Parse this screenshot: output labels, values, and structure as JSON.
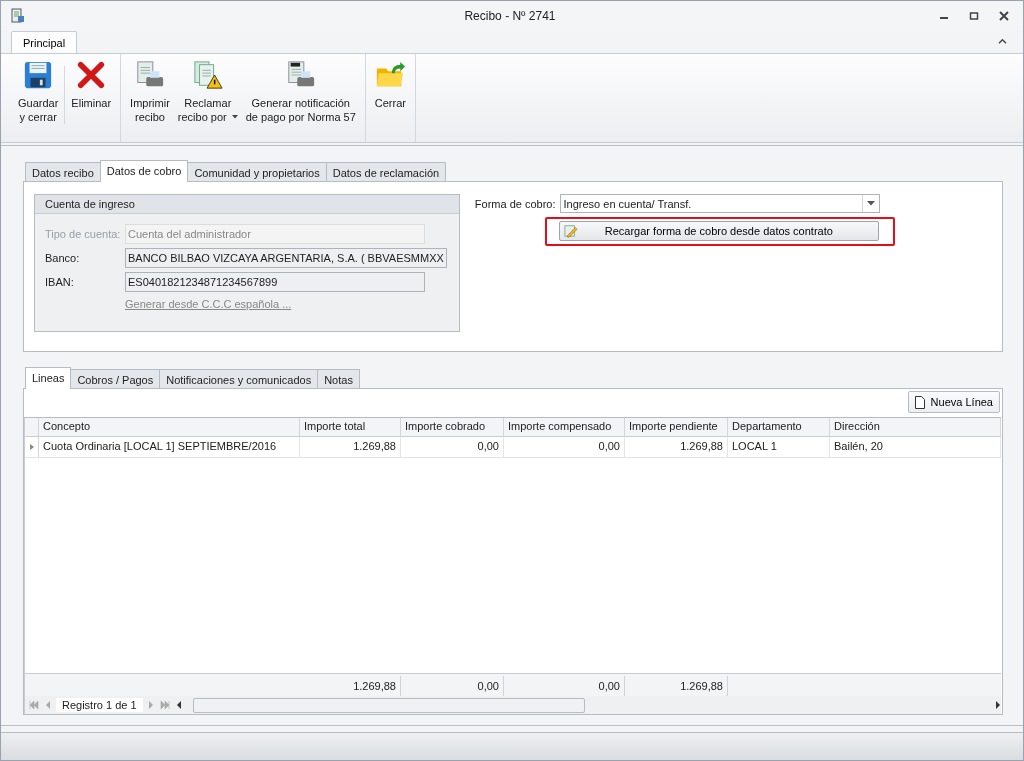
{
  "window": {
    "title": "Recibo - Nº 2741"
  },
  "ribbon": {
    "tabs": [
      {
        "label": "Principal",
        "selected": true
      }
    ],
    "groups": [
      [
        {
          "lines": [
            "Guardar",
            "y cerrar"
          ],
          "kind": "save",
          "dropdown": false
        },
        {
          "lines": [
            "Eliminar"
          ],
          "kind": "delete",
          "dropdown": false
        }
      ],
      [
        {
          "lines": [
            "Imprimir",
            "recibo"
          ],
          "kind": "print",
          "dropdown": false
        },
        {
          "lines": [
            "Reclamar",
            "recibo por"
          ],
          "kind": "claim",
          "dropdown": true
        },
        {
          "lines": [
            "Generar notificación",
            "de pago por Norma 57"
          ],
          "kind": "norma",
          "dropdown": false
        }
      ],
      [
        {
          "lines": [
            "Cerrar"
          ],
          "kind": "close",
          "dropdown": false
        }
      ]
    ]
  },
  "form_tabs": [
    {
      "label": "Datos recibo",
      "selected": false
    },
    {
      "label": "Datos de cobro",
      "selected": true
    },
    {
      "label": "Comunidad y propietarios",
      "selected": false
    },
    {
      "label": "Datos de reclamación",
      "selected": false
    }
  ],
  "account_group": {
    "title": "Cuenta de ingreso",
    "fields": [
      {
        "label": "Tipo de cuenta:",
        "value": "Cuenta del administrador",
        "disabled": true
      },
      {
        "label": "Banco:",
        "value": "BANCO BILBAO VIZCAYA ARGENTARIA, S.A. ( BBVAESMMXX",
        "disabled": false
      },
      {
        "label": "IBAN:",
        "value": "ES0401821234871234567899",
        "disabled": false
      }
    ],
    "link": "Generar desde C.C.C española ..."
  },
  "payment_method": {
    "label": "Forma de cobro:",
    "value": "Ingreso en cuenta/ Transf.",
    "reload_button": "Recargar forma de cobro desde datos contrato",
    "highlighted": true
  },
  "lines_tabs": [
    {
      "label": "Lineas",
      "selected": true
    },
    {
      "label": "Cobros / Pagos",
      "selected": false
    },
    {
      "label": "Notificaciones y comunicados",
      "selected": false
    },
    {
      "label": "Notas",
      "selected": false
    }
  ],
  "new_line_button": "Nueva Línea",
  "table": {
    "columns": [
      "Concepto",
      "Importe total",
      "Importe cobrado",
      "Importe compensado",
      "Importe pendiente",
      "Departamento",
      "Dirección"
    ],
    "rows": [
      {
        "cells": [
          "Cuota Ordinaria [LOCAL 1] SEPTIEMBRE/2016",
          "1.269,88",
          "0,00",
          "0,00",
          "1.269,88",
          "LOCAL 1",
          "Bailén, 20"
        ],
        "selected": true
      }
    ],
    "totals": [
      "1.269,88",
      "0,00",
      "0,00",
      "1.269,88"
    ]
  },
  "navigator": {
    "text": "Registro 1 de 1"
  }
}
